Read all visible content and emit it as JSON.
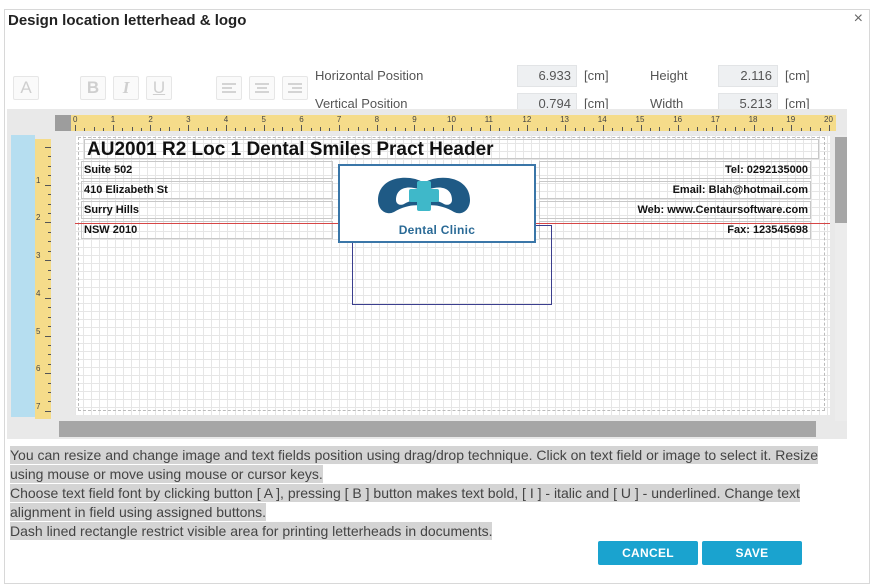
{
  "dialog": {
    "title": "Design location letterhead & logo",
    "close_glyph": "×"
  },
  "toolbar": {
    "font_label": "A",
    "bold_label": "B",
    "italic_label": "I",
    "underline_label": "U",
    "align_left_icon": "align-left-icon",
    "align_center_icon": "align-center-icon",
    "align_right_icon": "align-right-icon"
  },
  "position": {
    "horizontal_label": "Horizontal Position",
    "horizontal_value": "6.933",
    "vertical_label": "Vertical Position",
    "vertical_value": "0.794",
    "height_label": "Height",
    "height_value": "2.116",
    "width_label": "Width",
    "width_value": "5.213",
    "unit": "[cm]"
  },
  "ruler": {
    "h_ticks": [
      "0",
      "1",
      "2",
      "3",
      "4",
      "5",
      "6",
      "7",
      "8",
      "9",
      "10",
      "11",
      "12",
      "13",
      "14",
      "15",
      "16",
      "17",
      "18",
      "19",
      "20"
    ],
    "v_ticks": [
      "1",
      "2",
      "3",
      "4",
      "5",
      "6",
      "7"
    ]
  },
  "letterhead": {
    "header": "AU2001 R2 Loc 1 Dental Smiles Pract Header",
    "address_lines": [
      "Suite 502",
      "410 Elizabeth St",
      "Surry Hills",
      "NSW 2010"
    ],
    "contact_lines": [
      "Tel: 0292135000",
      "Email: Blah@hotmail.com",
      "Web: www.Centaursoftware.com",
      "Fax: 123545698"
    ],
    "logo_text": "Dental Clinic",
    "logo_colors": {
      "tooth": "#1f5a85",
      "cross": "#3fb8c9"
    }
  },
  "help": {
    "line1": "You can resize and change image and text fields position using drag/drop technique. Click on text field or image to select it. Resize using mouse or move using mouse or cursor keys.",
    "line2": "Choose text field font by clicking button [ A ], pressing [ B ] button makes text bold, [ I ] - italic and [ U ] - underlined. Change text alignment in field using assigned buttons.",
    "line3": "Dash lined rectangle restrict visible area for printing letterheads in documents."
  },
  "buttons": {
    "cancel": "CANCEL",
    "save": "SAVE"
  },
  "colors": {
    "accent": "#1aa3cf",
    "ruler": "#f5dc8a",
    "side_strip": "#b6def0",
    "baseline": "#d64545"
  }
}
